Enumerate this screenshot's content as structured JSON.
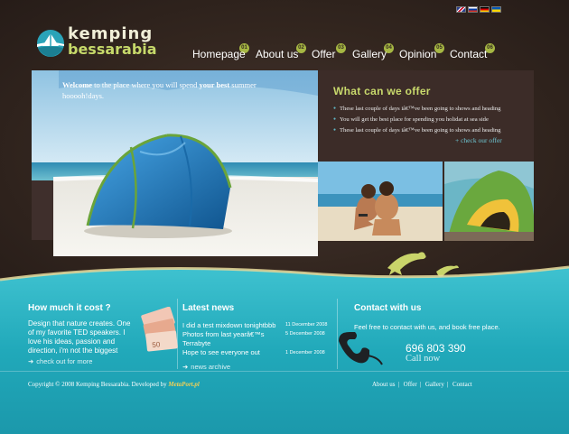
{
  "languages": [
    {
      "name": "english-flag",
      "colors": [
        "#2a3f8c",
        "#c8102e"
      ]
    },
    {
      "name": "russian-flag",
      "colors": [
        "#ffffff",
        "#0039a6",
        "#d52b1e"
      ]
    },
    {
      "name": "german-flag",
      "colors": [
        "#000000",
        "#dd0000",
        "#ffce00"
      ]
    },
    {
      "name": "ukrainian-flag",
      "colors": [
        "#0057b7",
        "#ffd700"
      ]
    }
  ],
  "logo": {
    "line1": "kemping",
    "line2": "bessarabia"
  },
  "nav": [
    {
      "label": "Homepage",
      "num": "01"
    },
    {
      "label": "About us",
      "num": "02"
    },
    {
      "label": "Offer",
      "num": "03"
    },
    {
      "label": "Gallery",
      "num": "04"
    },
    {
      "label": "Opinion",
      "num": "05"
    },
    {
      "label": "Contact",
      "num": "06"
    }
  ],
  "hero": {
    "w1": "Welcome",
    "w2": " to the place where you will spend ",
    "w3": "your best",
    "w4": " summer hooooh!days."
  },
  "offer": {
    "title": "What can we offer",
    "items": [
      "These last couple of days iâ€™ve been going to shows and heading",
      "You will get the best place for spending you holidat at sea side",
      "These last couple of days iâ€™ve been going to shows and heading"
    ],
    "link": "+ check our offer"
  },
  "cost": {
    "title": "How much it cost ?",
    "text": "Design that nature creates. One of my favorite TED speakers. I love his ideas, passion and direction, i'm not the biggest",
    "link": "check out for more"
  },
  "news": {
    "title": "Latest news",
    "items": [
      {
        "text": "I did a test mixdown tonightbbb",
        "date": "11 December 2008"
      },
      {
        "text": "Photos from last yearâ€™s Terrabyte",
        "date": "5 December 2008"
      },
      {
        "text": "Hope to see everyone out",
        "date": "1 December 2008"
      }
    ],
    "link": "news archive"
  },
  "contact": {
    "title": "Contact with us",
    "text": "Feel free to contact with us, and book free place.",
    "phone": "696 803 390",
    "call": "Call now"
  },
  "footer": {
    "copy": "Copyright © 2008 Kemping Bessarabia. Developed by ",
    "brand": "MetaPort.pl",
    "links": [
      "About us",
      "Offer",
      "Gallery",
      "Contact"
    ]
  },
  "colors": {
    "accent": "#c8d96c",
    "teal": "#27b3c2",
    "dark": "#2f231f"
  }
}
